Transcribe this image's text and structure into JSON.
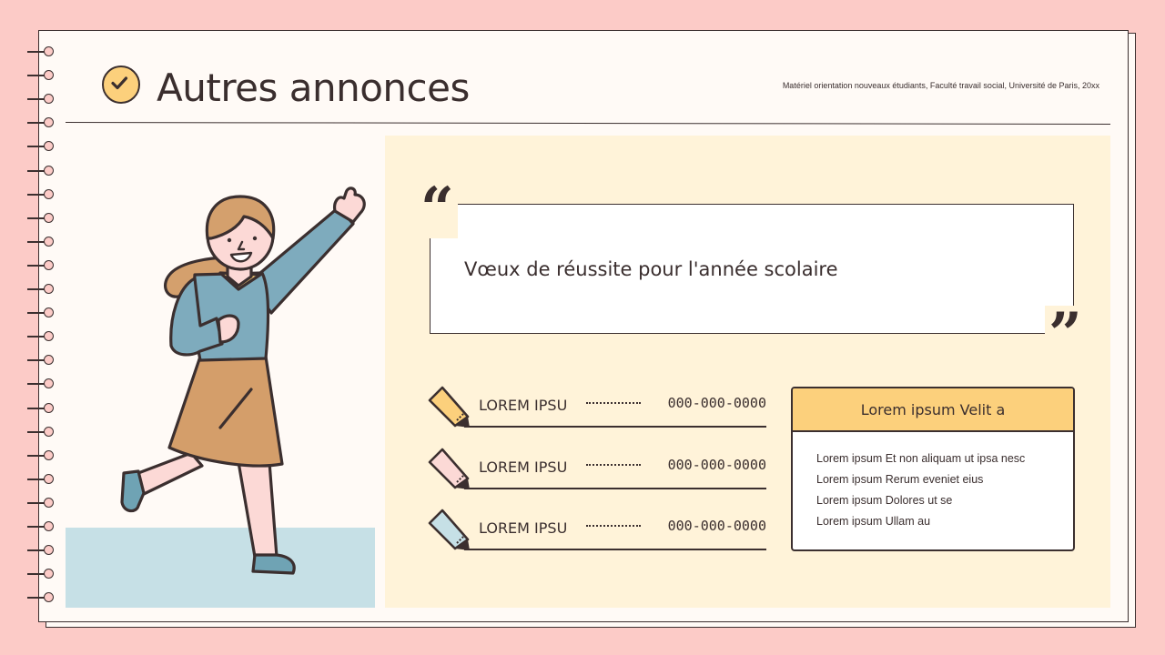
{
  "slide": {
    "title": "Autres annonces",
    "subtitle": "Matériel orientation nouveaux étudiants, Faculté travail social, Université de Paris, 20xx",
    "title_icon": "check-icon"
  },
  "quote": {
    "text": "Vœux de réussite pour l'année scolaire",
    "open_mark": "“",
    "close_mark": "”"
  },
  "contacts": [
    {
      "label": "LOREM IPSU",
      "phone": "000-000-0000",
      "pencil_color": "#fcd07c"
    },
    {
      "label": "LOREM IPSU",
      "phone": "000-000-0000",
      "pencil_color": "#fcd9d6"
    },
    {
      "label": "LOREM IPSU",
      "phone": "000-000-0000",
      "pencil_color": "#c6e0e6"
    }
  ],
  "info_card": {
    "title": "Lorem ipsum Velit a",
    "items": [
      "Lorem ipsum Et non aliquam ut ipsa nesc",
      "Lorem ipsum Rerum eveniet eius",
      "Lorem ipsum Dolores ut se",
      "Lorem ipsum Ullam au"
    ]
  },
  "colors": {
    "background": "#fccbc7",
    "paper": "#fffaf6",
    "panel": "#fff3d9",
    "accent_yellow": "#fcd07c",
    "accent_blue": "#c6e0e6",
    "ink": "#3b2f2f"
  }
}
